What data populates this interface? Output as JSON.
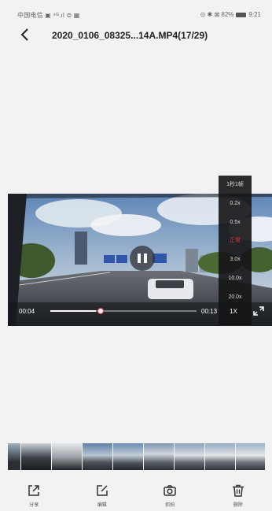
{
  "status_bar": {
    "left_text": "中国电信 ▣ ⁴ᴳ.ıl ⊜ ▦",
    "right_text": "⊙ ✱ ⊠ 82%",
    "time": "9:21"
  },
  "header": {
    "title": "2020_0106_08325...14A.MP4(17/29)"
  },
  "player": {
    "current_time": "00:04",
    "total_time": "00:13",
    "speed_label": "1X",
    "progress_fraction": 0.31,
    "state": "playing"
  },
  "speed_menu": {
    "items": [
      "1秒1帧",
      "0.2x",
      "0.5x",
      "正常",
      "3.0x",
      "10.0x",
      "20.0x"
    ],
    "active_index": 3
  },
  "thumbnails": {
    "count": 9
  },
  "toolbar": {
    "items": [
      {
        "label": "分享",
        "icon": "share-icon"
      },
      {
        "label": "编辑",
        "icon": "edit-icon"
      },
      {
        "label": "抓拍",
        "icon": "camera-icon"
      },
      {
        "label": "删除",
        "icon": "trash-icon"
      }
    ]
  },
  "colors": {
    "accent": "#e53935",
    "background": "#f2f2f2",
    "menu_bg": "#141416"
  }
}
